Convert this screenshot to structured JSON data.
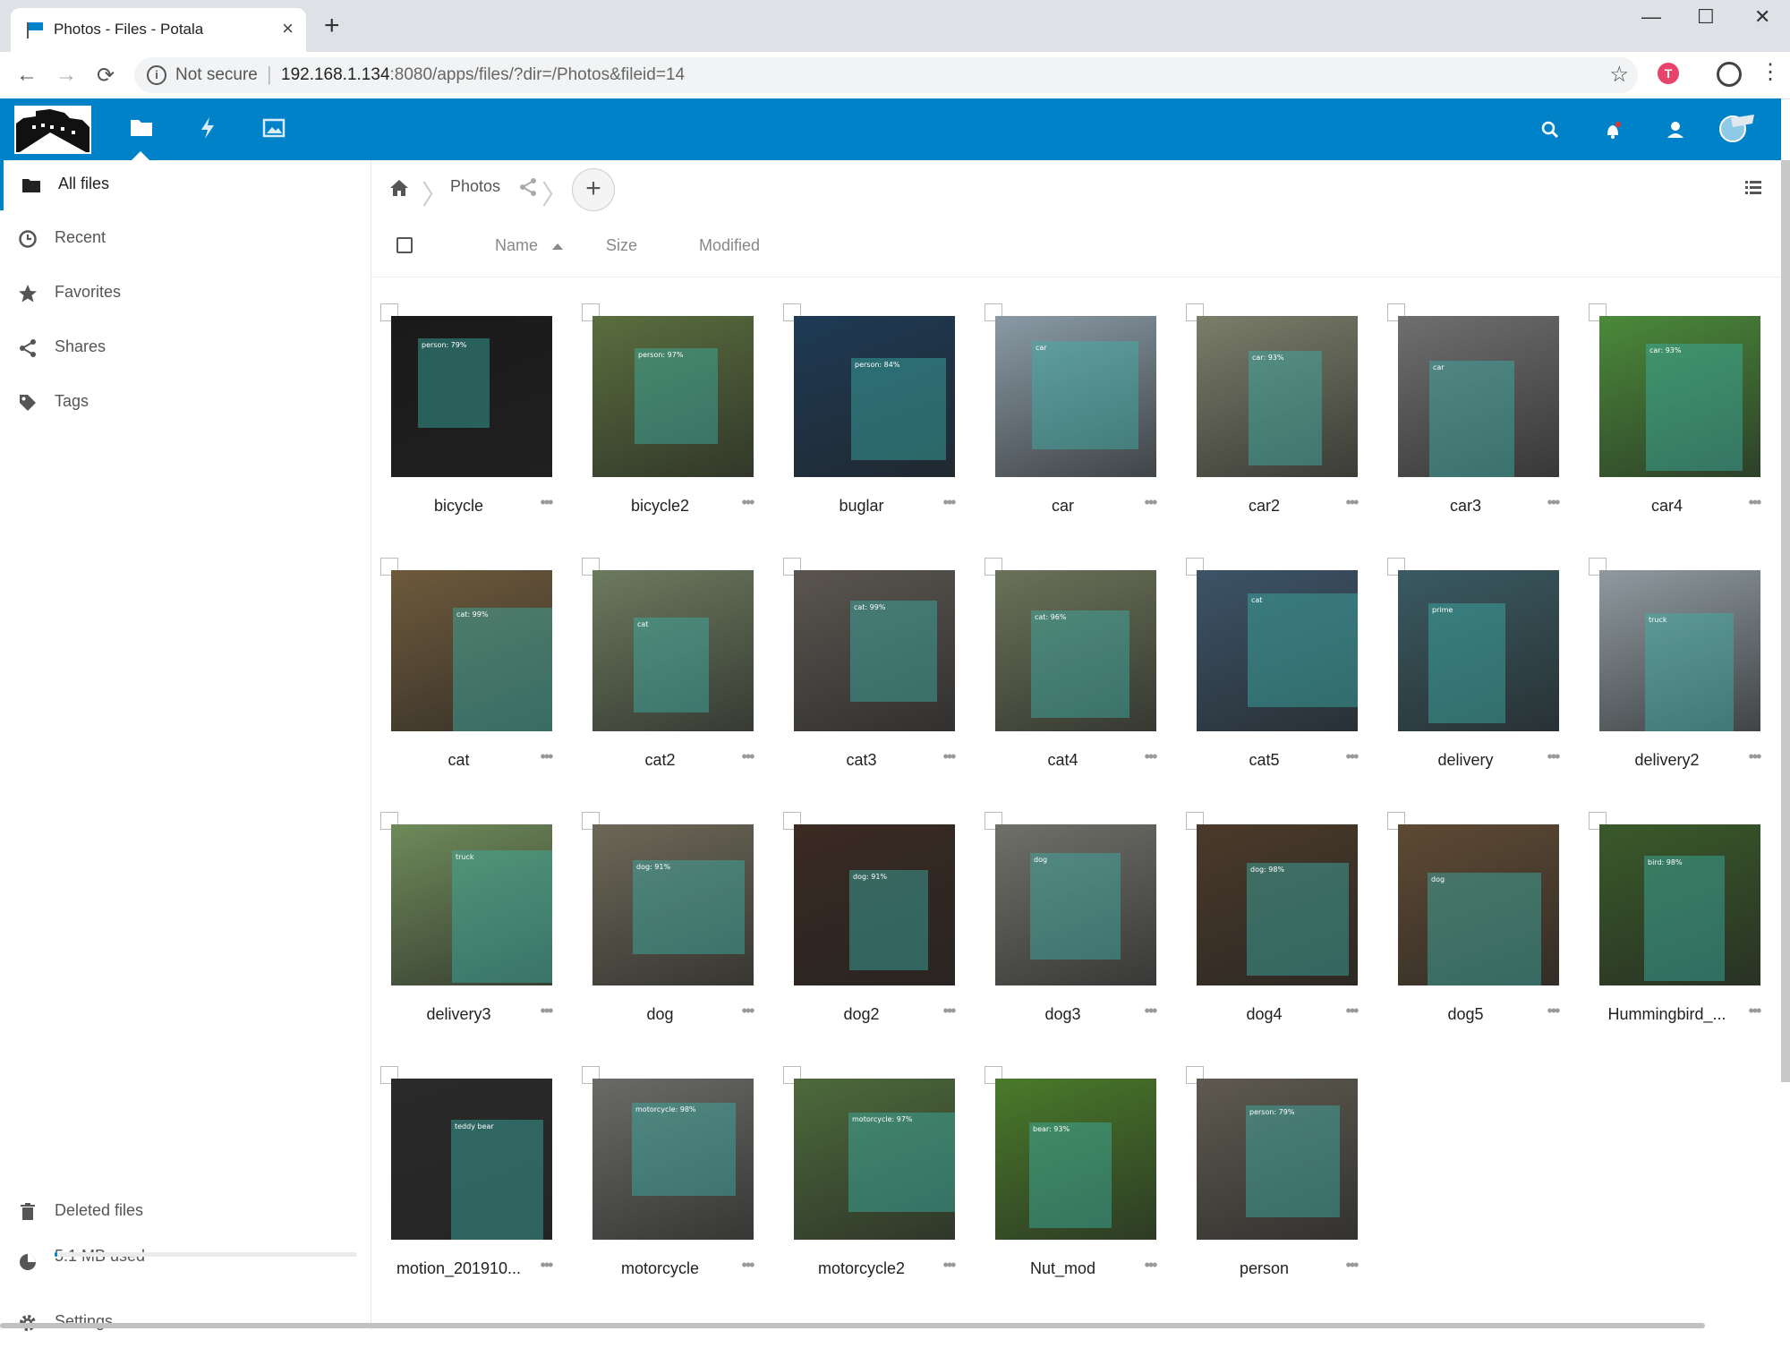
{
  "browser": {
    "tab_title": "Photos - Files - Potala",
    "tab_close": "×",
    "new_tab": "+",
    "url_notsecure": "Not secure",
    "url_host": "192.168.1.134",
    "url_rest": ":8080/apps/files/?dir=/Photos&fileid=14",
    "win_min": "—",
    "win_max": "☐",
    "win_close": "✕",
    "back": "←",
    "forward": "→",
    "reload": "⟳",
    "star": "☆",
    "menu": "⋮",
    "ext_letter": "T"
  },
  "sidebar": {
    "items": [
      {
        "label": "All files",
        "icon": "folder-icon"
      },
      {
        "label": "Recent",
        "icon": "clock-icon"
      },
      {
        "label": "Favorites",
        "icon": "star-icon"
      },
      {
        "label": "Shares",
        "icon": "share-icon"
      },
      {
        "label": "Tags",
        "icon": "tag-icon"
      }
    ],
    "deleted_label": "Deleted files",
    "quota_label": "5.1 MB used",
    "settings_label": "Settings",
    "accent": "#0082c9"
  },
  "breadcrumb": {
    "folder": "Photos",
    "add": "+"
  },
  "columns": {
    "name": "Name",
    "size": "Size",
    "modified": "Modified"
  },
  "files": [
    {
      "name": "bicycle",
      "bg": "#1a1a1a",
      "tag": "person: 79%"
    },
    {
      "name": "bicycle2",
      "bg": "#5a6e3e",
      "tag": "person: 97%"
    },
    {
      "name": "buglar",
      "bg": "#1e3a55",
      "tag": "person: 84%"
    },
    {
      "name": "car",
      "bg": "#8a9aa5",
      "tag": "car"
    },
    {
      "name": "car2",
      "bg": "#7a7e6a",
      "tag": "car: 93%"
    },
    {
      "name": "car3",
      "bg": "#6f6f70",
      "tag": "car"
    },
    {
      "name": "car4",
      "bg": "#4b8a3a",
      "tag": "car: 93%"
    },
    {
      "name": "cat",
      "bg": "#6e5a3c",
      "tag": "cat: 99%"
    },
    {
      "name": "cat2",
      "bg": "#6c7a5e",
      "tag": "cat"
    },
    {
      "name": "cat3",
      "bg": "#5a5550",
      "tag": "cat: 99%"
    },
    {
      "name": "cat4",
      "bg": "#6a7258",
      "tag": "cat: 96%"
    },
    {
      "name": "cat5",
      "bg": "#3c5468",
      "tag": "cat"
    },
    {
      "name": "delivery",
      "bg": "#3a5a62",
      "tag": "prime"
    },
    {
      "name": "delivery2",
      "bg": "#8f9aa0",
      "tag": "truck"
    },
    {
      "name": "delivery3",
      "bg": "#6f8a5a",
      "tag": "truck"
    },
    {
      "name": "dog",
      "bg": "#6c6858",
      "tag": "dog: 91%"
    },
    {
      "name": "dog2",
      "bg": "#3a2a22",
      "tag": "dog: 91%"
    },
    {
      "name": "dog3",
      "bg": "#70706a",
      "tag": "dog"
    },
    {
      "name": "dog4",
      "bg": "#4a3a2a",
      "tag": "dog: 98%"
    },
    {
      "name": "dog5",
      "bg": "#5e4a34",
      "tag": "dog"
    },
    {
      "name": "Hummingbird_...",
      "bg": "#3a5a2a",
      "tag": "bird: 98%"
    },
    {
      "name": "motion_201910...",
      "bg": "#2a2a2a",
      "tag": "teddy bear"
    },
    {
      "name": "motorcycle",
      "bg": "#6a6a66",
      "tag": "motorcycle: 98%"
    },
    {
      "name": "motorcycle2",
      "bg": "#4e6a3c",
      "tag": "motorcycle: 97%"
    },
    {
      "name": "Nut_mod",
      "bg": "#4a7a2a",
      "tag": "bear: 93%"
    },
    {
      "name": "person",
      "bg": "#5e5a50",
      "tag": "person: 79%"
    }
  ]
}
